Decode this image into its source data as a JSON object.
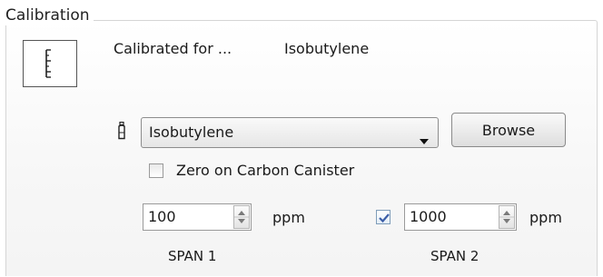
{
  "group": {
    "title": "Calibration"
  },
  "calibration": {
    "status_label": "Calibrated for ...",
    "gas_name": "Isobutylene"
  },
  "gas_select": {
    "selected": "Isobutylene",
    "browse_label": "Browse"
  },
  "zero_carbon": {
    "label": "Zero on Carbon Canister",
    "checked": false
  },
  "span1": {
    "value": "100",
    "unit": "ppm",
    "label": "SPAN 1"
  },
  "span2": {
    "enabled": true,
    "value": "1000",
    "unit": "ppm",
    "label": "SPAN 2"
  },
  "icons": {
    "calibration": "calibration-ruler-icon",
    "gas_cylinder": "gas-cylinder-icon",
    "dropdown": "chevron-down-icon",
    "spinner": "spin-up-down-icon",
    "check": "checkmark-icon"
  },
  "colors": {
    "check_accent": "#3c5fa8",
    "group_border": "#d5d5d5"
  }
}
